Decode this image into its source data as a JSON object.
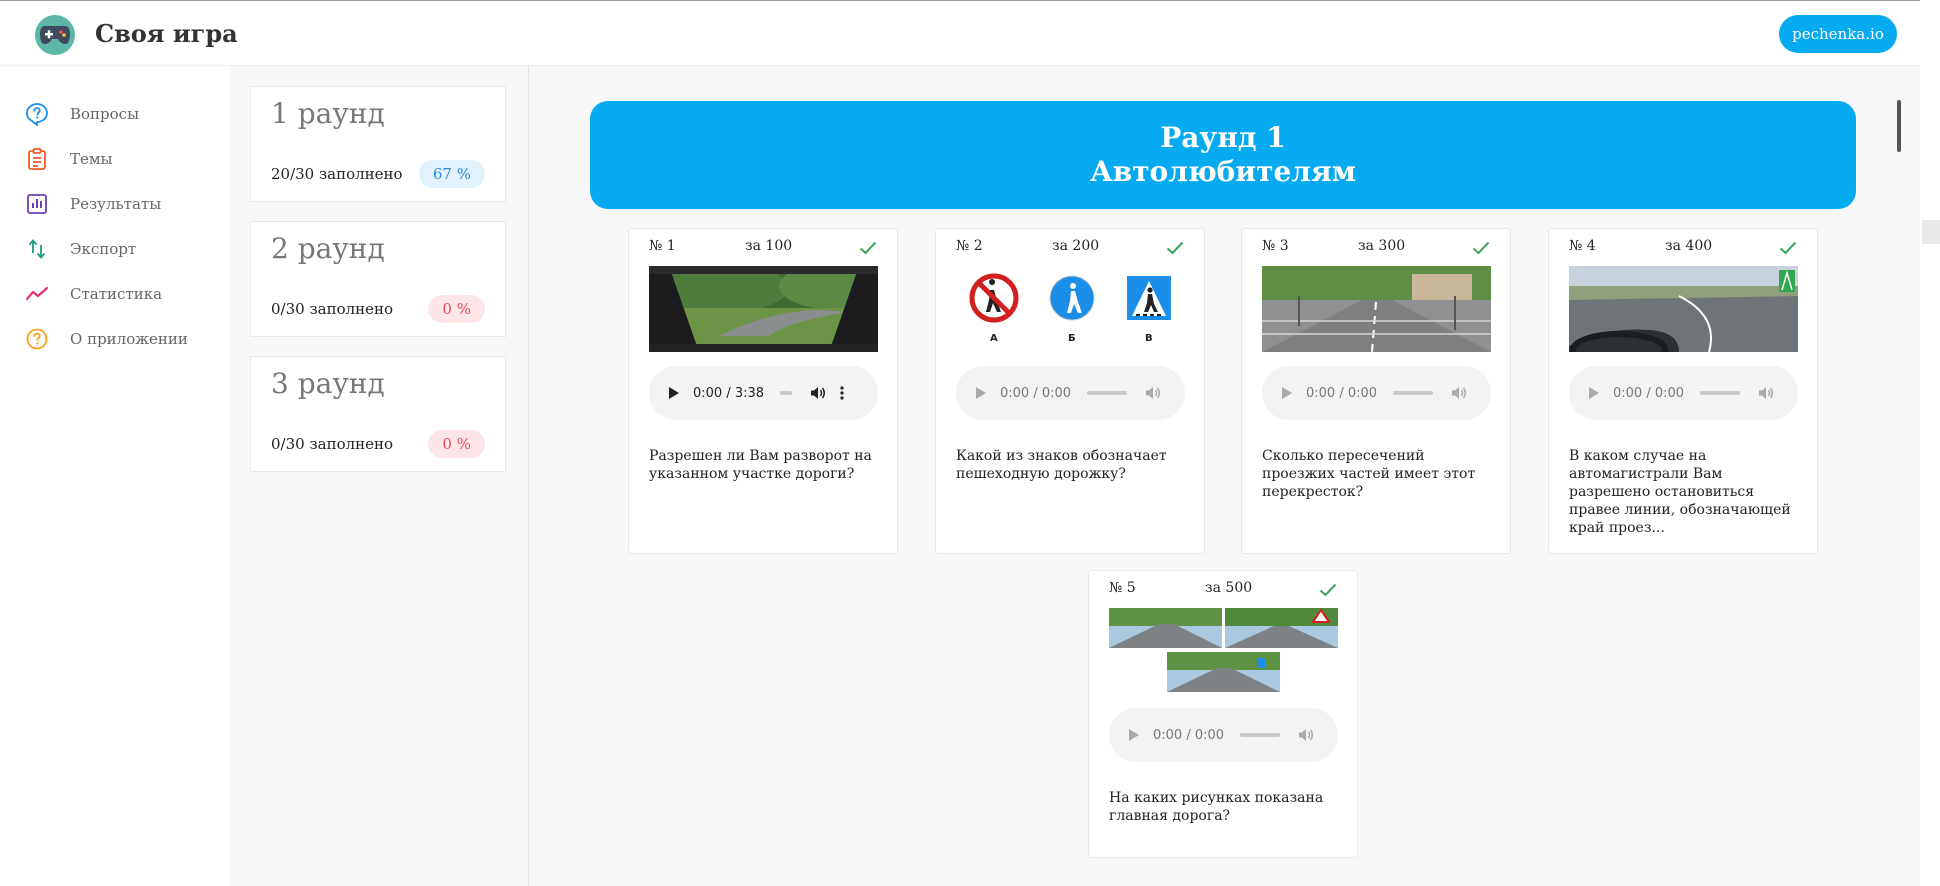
{
  "header": {
    "app_title": "Своя игра",
    "site_button": "pechenka.io"
  },
  "sidebar": {
    "items": [
      {
        "label": "Вопросы",
        "icon": "question-circle-icon",
        "color": "#1a8ee8"
      },
      {
        "label": "Темы",
        "icon": "clipboard-icon",
        "color": "#f0592a"
      },
      {
        "label": "Результаты",
        "icon": "bar-chart-icon",
        "color": "#6b3fb8"
      },
      {
        "label": "Экспорт",
        "icon": "transfer-arrows-icon",
        "color": "#1b9a8a"
      },
      {
        "label": "Статистика",
        "icon": "trend-line-icon",
        "color": "#e6316b"
      },
      {
        "label": "О приложении",
        "icon": "help-circle-icon",
        "color": "#f5a020"
      }
    ]
  },
  "rounds": [
    {
      "title": "1 раунд",
      "filled": "20/30 заполнено",
      "percent": "67 %",
      "status": "blue"
    },
    {
      "title": "2 раунд",
      "filled": "0/30 заполнено",
      "percent": "0 %",
      "status": "red"
    },
    {
      "title": "3 раунд",
      "filled": "0/30 заполнено",
      "percent": "0 %",
      "status": "red"
    }
  ],
  "banner": {
    "line1": "Раунд 1",
    "line2": "Автолюбителям"
  },
  "questions": [
    {
      "number": "№ 1",
      "price": "за 100",
      "audio_time": "0:00 / 3:38",
      "audio_loaded": true,
      "text": "Разрешен ли Вам разворот на указанном участке дороги?",
      "image": "driver-view-road-turn-image"
    },
    {
      "number": "№ 2",
      "price": "за 200",
      "audio_time": "0:00 / 0:00",
      "audio_loaded": false,
      "text": "Какой из знаков обозначает пешеходную дорожку?",
      "image": "three-road-signs-image",
      "sign_labels": [
        "А",
        "Б",
        "В"
      ]
    },
    {
      "number": "№ 3",
      "price": "за 300",
      "audio_time": "0:00 / 0:00",
      "audio_loaded": false,
      "text": "Сколько пересечений проезжих частей имеет этот перекресток?",
      "image": "intersection-image"
    },
    {
      "number": "№ 4",
      "price": "за 400",
      "audio_time": "0:00 / 0:00",
      "audio_loaded": false,
      "text": "В каком случае на автомагистрали Вам разрешено остановиться правее линии, обозначающей край проез...",
      "image": "highway-image"
    },
    {
      "number": "№ 5",
      "price": "за 500",
      "audio_time": "0:00 / 0:00",
      "audio_loaded": false,
      "text": "На каких рисунках показана главная дорога?",
      "image": "three-road-photos-image"
    }
  ],
  "colors": {
    "accent": "#05aaf0",
    "check": "#3aa55a",
    "badge_blue_text": "#2d8ad4",
    "badge_red_text": "#e84b5e"
  }
}
